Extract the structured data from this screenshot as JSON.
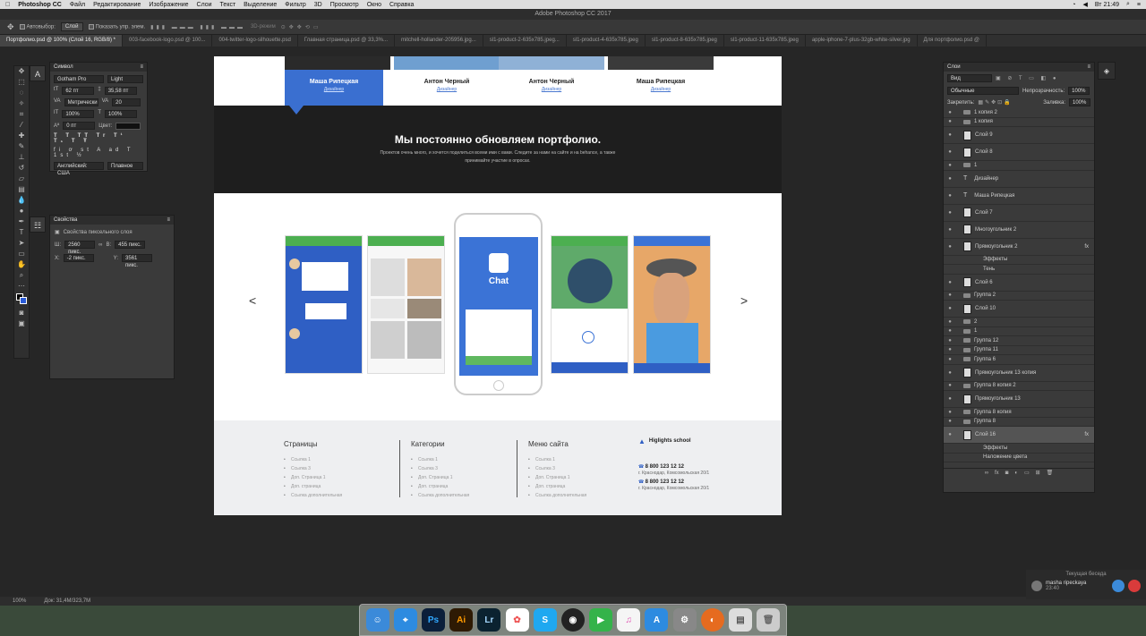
{
  "menubar": {
    "app": "Photoshop CC",
    "items": [
      "Файл",
      "Редактирование",
      "Изображение",
      "Слои",
      "Текст",
      "Выделение",
      "Фильтр",
      "3D",
      "Просмотр",
      "Окно",
      "Справка"
    ],
    "clock": "Вт 21:49"
  },
  "window_title": "Adobe Photoshop CC 2017",
  "options": {
    "autoselect_label": "Автовыбор:",
    "autoselect_value": "Слой",
    "show_controls": "Показать упр. элем.",
    "mode_3d": "3D-режим"
  },
  "tabs": [
    "Портфолио.psd @ 100% (Слой 16, RGB/8) *",
    "003-facebook-logo.psd @ 100...",
    "004-twitter-logo-silhouette.psd",
    "Главная страница.psd @ 33,3%...",
    "mitchell-hollander-205956.jpg...",
    "sl1-product-2-635x785.jpeg...",
    "sl1-product-4-635x785.jpeg",
    "sl1-product-8-635x785.jpeg",
    "sl1-product-11-635x785.jpeg",
    "apple-iphone-7-plus-32gb-white-silver.jpg",
    "Для портфолио.psd @"
  ],
  "character_panel": {
    "title": "Символ",
    "font": "Gotham Pro",
    "style": "Light",
    "size": "62 пт",
    "leading": "35,58 пт",
    "kerning": "Метрически",
    "tracking": "20",
    "vscale": "100%",
    "hscale": "100%",
    "baseline": "0 пт",
    "color_label": "Цвет:",
    "language": "Английский: США",
    "aa": "Плавное"
  },
  "properties_panel": {
    "title": "Свойства",
    "subtitle": "Свойства пиксельного слоя",
    "w": "2560 пикс.",
    "h": "455 пикс.",
    "x": "-2 пикс.",
    "y": "3561 пикс."
  },
  "canvas": {
    "team": [
      {
        "name": "Маша Рипецкая",
        "role": "Дизайнер"
      },
      {
        "name": "Антон Черный",
        "role": "Дизайнер"
      },
      {
        "name": "Антон Черный",
        "role": "Дизайнер"
      },
      {
        "name": "Маша Рипецкая",
        "role": "Дизайнер"
      }
    ],
    "heading": "Мы постоянно обновляем портфолио.",
    "subtext": "Проектов очень много, и хочется поделиться всеми ими с вами. Следите за нами на сайте и на behance, а также принимайте участие в опросах.",
    "prev": "<",
    "next": ">",
    "chat_label": "Chat",
    "footer": {
      "col1": {
        "title": "Страницы",
        "links": [
          "Ссылка 1",
          "Ссылка 3",
          "Доп. Страница 1",
          "Доп. страница",
          "Ссылка дополнительная"
        ]
      },
      "col2": {
        "title": "Категории",
        "links": [
          "Ссылка 1",
          "Ссылка 3",
          "Доп. Страница 1",
          "Доп. страница",
          "Ссылка дополнительная"
        ]
      },
      "col3": {
        "title": "Меню сайта",
        "links": [
          "Ссылка 1",
          "Ссылка 3",
          "Доп. Страница 1",
          "Доп. страница",
          "Ссылка дополнительная"
        ]
      },
      "brand": "Higlights school",
      "phone1": "8 800 123 12 12",
      "addr1": "г. Краснодар, Комсомольская 20/1",
      "phone2": "8 800 123 12 12",
      "addr2": "г. Краснодар, Комсомольская 20/1"
    }
  },
  "layers_panel": {
    "title": "Слои",
    "filter": "Вид",
    "blend": "Обычные",
    "opacity_label": "Непрозрачность:",
    "opacity": "100%",
    "lock_label": "Закрепить:",
    "fill_label": "Заливка:",
    "fill": "100%",
    "rows": [
      {
        "name": "1 копия 2",
        "kind": "folder",
        "small": true
      },
      {
        "name": "1 копия",
        "kind": "folder",
        "small": true
      },
      {
        "name": "Слой 9",
        "kind": "layer"
      },
      {
        "name": "Слой 8",
        "kind": "layer"
      },
      {
        "name": "1",
        "kind": "folder",
        "small": true
      },
      {
        "name": "Дизайнер",
        "kind": "text"
      },
      {
        "name": "Маша Рипецкая",
        "kind": "text"
      },
      {
        "name": "Слой 7",
        "kind": "layer"
      },
      {
        "name": "Многоугольник 2",
        "kind": "layer"
      },
      {
        "name": "Прямоугольник 2",
        "kind": "layer",
        "fx": true
      },
      {
        "name": "Эффекты",
        "kind": "effect",
        "small": true
      },
      {
        "name": "Тень",
        "kind": "effect",
        "small": true
      },
      {
        "name": "Слой 6",
        "kind": "layer"
      },
      {
        "name": "Группа 2",
        "kind": "folder",
        "small": true
      },
      {
        "name": "Слой 10",
        "kind": "layer"
      },
      {
        "name": "2",
        "kind": "folder",
        "small": true
      },
      {
        "name": "1",
        "kind": "folder",
        "small": true
      },
      {
        "name": "Группа 12",
        "kind": "folder",
        "small": true
      },
      {
        "name": "Группа 11",
        "kind": "folder",
        "small": true
      },
      {
        "name": "Группа 6",
        "kind": "folder",
        "small": true
      },
      {
        "name": "Прямоугольник 13 копия",
        "kind": "layer"
      },
      {
        "name": "Группа 8 копия 2",
        "kind": "folder",
        "small": true
      },
      {
        "name": "Прямоугольник 13",
        "kind": "layer"
      },
      {
        "name": "Группа 8 копия",
        "kind": "folder",
        "small": true
      },
      {
        "name": "Группа 8",
        "kind": "folder",
        "small": true
      },
      {
        "name": "Слой 16",
        "kind": "layer",
        "fx": true,
        "selected": true
      },
      {
        "name": "Эффекты",
        "kind": "effect",
        "small": true
      },
      {
        "name": "Наложение цвета",
        "kind": "effect",
        "small": true
      }
    ]
  },
  "status": {
    "zoom": "100%",
    "doc": "Док: 31,4M/323,7M"
  },
  "notification": {
    "title": "Текущая беседа",
    "user": "masha ripeckaya",
    "time": "23:40"
  },
  "dock": [
    "Finder",
    "Safari",
    "Ps",
    "Ai",
    "Lr",
    "Photos",
    "Skype",
    "OBS",
    "FaceTime",
    "iTunes",
    "App Store",
    "System Preferences",
    "Firefox",
    "Preview",
    "Trash"
  ]
}
